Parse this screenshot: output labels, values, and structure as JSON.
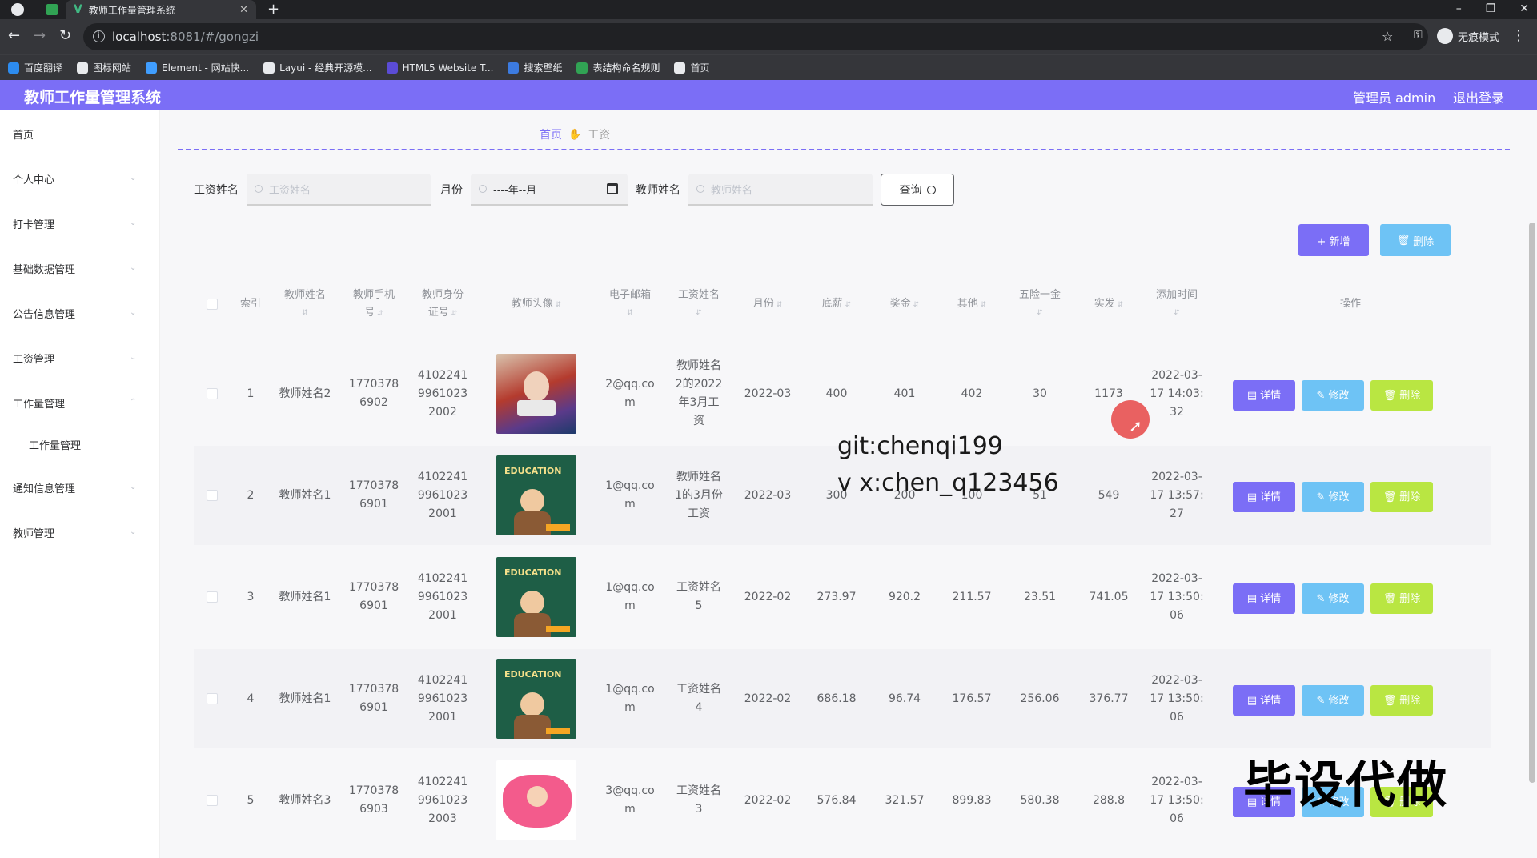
{
  "browser": {
    "tab_title": "教师工作量管理系统",
    "tab_close": "✕",
    "new_tab": "+",
    "url_host": "localhost",
    "url_rest": ":8081/#/gongzi",
    "incognito_label": "无痕模式",
    "bookmarks": [
      {
        "label": "百度翻译",
        "color": "#2d8cf0"
      },
      {
        "label": "图标网站",
        "color": "#e8eaed"
      },
      {
        "label": "Element - 网站快...",
        "color": "#409eff"
      },
      {
        "label": "Layui - 经典开源模...",
        "color": "#e8eaed"
      },
      {
        "label": "HTML5 Website T...",
        "color": "#5b4cd6"
      },
      {
        "label": "搜索壁纸",
        "color": "#3c7be0"
      },
      {
        "label": "表结构命名规则",
        "color": "#31a354"
      },
      {
        "label": "首页",
        "color": "#e8eaed"
      }
    ]
  },
  "header": {
    "title": "教师工作量管理系统",
    "user": "管理员 admin",
    "logout": "退出登录",
    "accent": "#7b6ef6"
  },
  "sidebar": {
    "items": [
      {
        "label": "首页"
      },
      {
        "label": "个人中心"
      },
      {
        "label": "打卡管理"
      },
      {
        "label": "基础数据管理"
      },
      {
        "label": "公告信息管理"
      },
      {
        "label": "工资管理"
      },
      {
        "label": "工作量管理"
      },
      {
        "label": "工作量管理"
      },
      {
        "label": "通知信息管理"
      },
      {
        "label": "教师管理"
      }
    ]
  },
  "breadcrumb": {
    "home": "首页",
    "current": "工资"
  },
  "search": {
    "salary_name_label": "工资姓名",
    "salary_name_placeholder": "工资姓名",
    "month_label": "月份",
    "month_value": "----年--月",
    "teacher_name_label": "教师姓名",
    "teacher_name_placeholder": "教师姓名",
    "query_button": "查询"
  },
  "actions": {
    "add": "+ 新增",
    "delete": "删除"
  },
  "table": {
    "columns": [
      "索引",
      "教师姓名",
      "教师手机号",
      "教师身份证号",
      "教师头像",
      "电子邮箱",
      "工资姓名",
      "月份",
      "底薪",
      "奖金",
      "其他",
      "五险一金",
      "实发",
      "添加时间",
      "操作"
    ],
    "header_lines": {
      "teacher_phone": [
        "教师手机",
        "号"
      ],
      "teacher_id": [
        "教师身份",
        "证号"
      ],
      "salary_name": [
        "工资姓名"
      ],
      "insurance": [
        "五险一金"
      ],
      "add_time": [
        "添加时间"
      ]
    },
    "rows": [
      {
        "index": "1",
        "teacher_name": "教师姓名2",
        "phone": [
          "1770378",
          "6902"
        ],
        "id_no": [
          "4102241",
          "9961023",
          "2002"
        ],
        "avatar": "photo",
        "email": [
          "2@qq.co",
          "m"
        ],
        "salary_name": [
          "教师姓名",
          "2的2022",
          "年3月工",
          "资"
        ],
        "month": "2022-03",
        "base": "400",
        "bonus": "401",
        "other": "402",
        "insurance": "30",
        "net": "1173",
        "added": [
          "2022-03-",
          "17 14:03:",
          "32"
        ]
      },
      {
        "index": "2",
        "teacher_name": "教师姓名1",
        "phone": [
          "1770378",
          "6901"
        ],
        "id_no": [
          "4102241",
          "9961023",
          "2001"
        ],
        "avatar": "education",
        "email": [
          "1@qq.co",
          "m"
        ],
        "salary_name": [
          "教师姓名",
          "1的3月份",
          "工资"
        ],
        "month": "2022-03",
        "base": "300",
        "bonus": "200",
        "other": "100",
        "insurance": "51",
        "net": "549",
        "added": [
          "2022-03-",
          "17 13:57:",
          "27"
        ]
      },
      {
        "index": "3",
        "teacher_name": "教师姓名1",
        "phone": [
          "1770378",
          "6901"
        ],
        "id_no": [
          "4102241",
          "9961023",
          "2001"
        ],
        "avatar": "education",
        "email": [
          "1@qq.co",
          "m"
        ],
        "salary_name": [
          "工资姓名",
          "5"
        ],
        "month": "2022-02",
        "base": "273.97",
        "bonus": "920.2",
        "other": "211.57",
        "insurance": "23.51",
        "net": "741.05",
        "added": [
          "2022-03-",
          "17 13:50:",
          "06"
        ]
      },
      {
        "index": "4",
        "teacher_name": "教师姓名1",
        "phone": [
          "1770378",
          "6901"
        ],
        "id_no": [
          "4102241",
          "9961023",
          "2001"
        ],
        "avatar": "education",
        "email": [
          "1@qq.co",
          "m"
        ],
        "salary_name": [
          "工资姓名",
          "4"
        ],
        "month": "2022-02",
        "base": "686.18",
        "bonus": "96.74",
        "other": "176.57",
        "insurance": "256.06",
        "net": "376.77",
        "added": [
          "2022-03-",
          "17 13:50:",
          "06"
        ]
      },
      {
        "index": "5",
        "teacher_name": "教师姓名3",
        "phone": [
          "1770378",
          "6903"
        ],
        "id_no": [
          "4102241",
          "9961023",
          "2003"
        ],
        "avatar": "love",
        "email": [
          "3@qq.co",
          "m"
        ],
        "salary_name": [
          "工资姓名",
          "3"
        ],
        "month": "2022-02",
        "base": "576.84",
        "bonus": "321.57",
        "other": "899.83",
        "insurance": "580.38",
        "net": "288.8",
        "added": [
          "2022-03-",
          "17 13:50:",
          "06"
        ]
      }
    ],
    "op_detail": "详情",
    "op_edit": "修改",
    "op_delete": "删除",
    "education_text": "EDUCATION"
  },
  "overlays": {
    "git": "git:chenqi199",
    "vx": "v x:chen_q123456",
    "big_watermark": "毕设代做"
  }
}
